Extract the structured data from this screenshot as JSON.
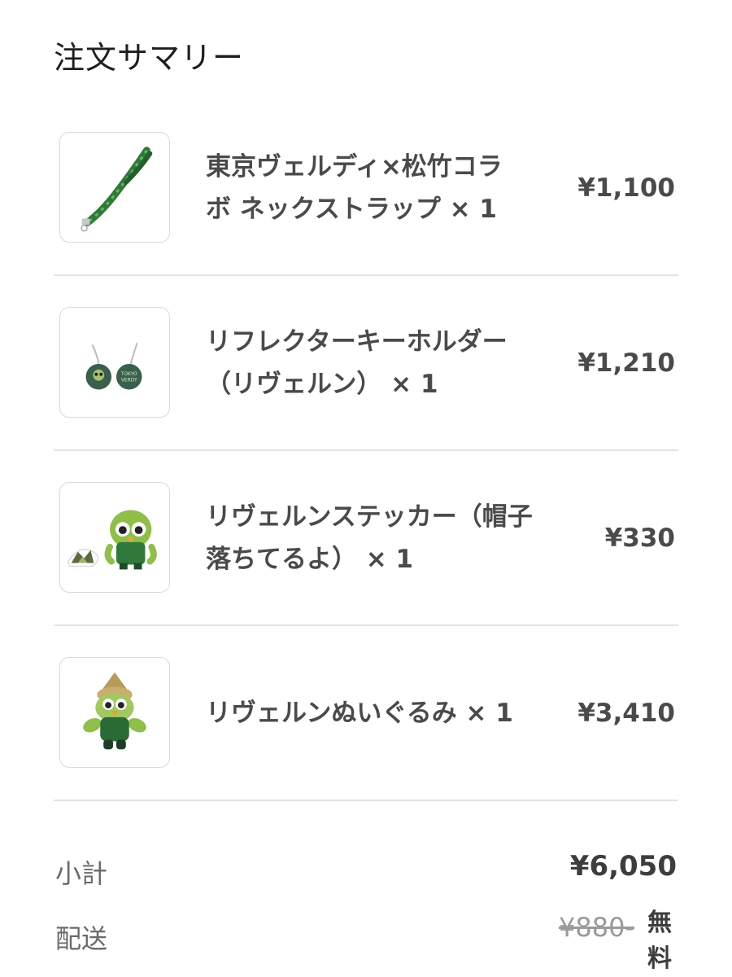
{
  "summary_title": "注文サマリー",
  "items": [
    {
      "name_line1": "東京ヴェルディ×松竹コラ",
      "name_line2": "ボ ネックストラップ × 1",
      "price": "¥1,100",
      "thumb_icon": "lanyard-icon"
    },
    {
      "name_line1": "リフレクターキーホルダー",
      "name_line2": "（リヴェルン） × 1",
      "price": "¥1,210",
      "thumb_icon": "keychain-icon",
      "thumb_text": "TOKYO VERDY"
    },
    {
      "name_line1": "リヴェルンステッカー（帽子",
      "name_line2": "落ちてるよ） × 1",
      "price": "¥330",
      "thumb_icon": "sticker-icon"
    },
    {
      "name_line1": "リヴェルンぬいぐるみ × 1",
      "name_line2": "",
      "price": "¥3,410",
      "thumb_icon": "plush-icon"
    }
  ],
  "subtotal": {
    "label": "小計",
    "value": "¥6,050"
  },
  "shipping": {
    "label": "配送",
    "original": "¥880-",
    "value": "無料"
  },
  "colors": {
    "product_green": "#2f7a3a",
    "product_dark_green": "#1f4a2c",
    "divider": "#e3e3e3"
  }
}
